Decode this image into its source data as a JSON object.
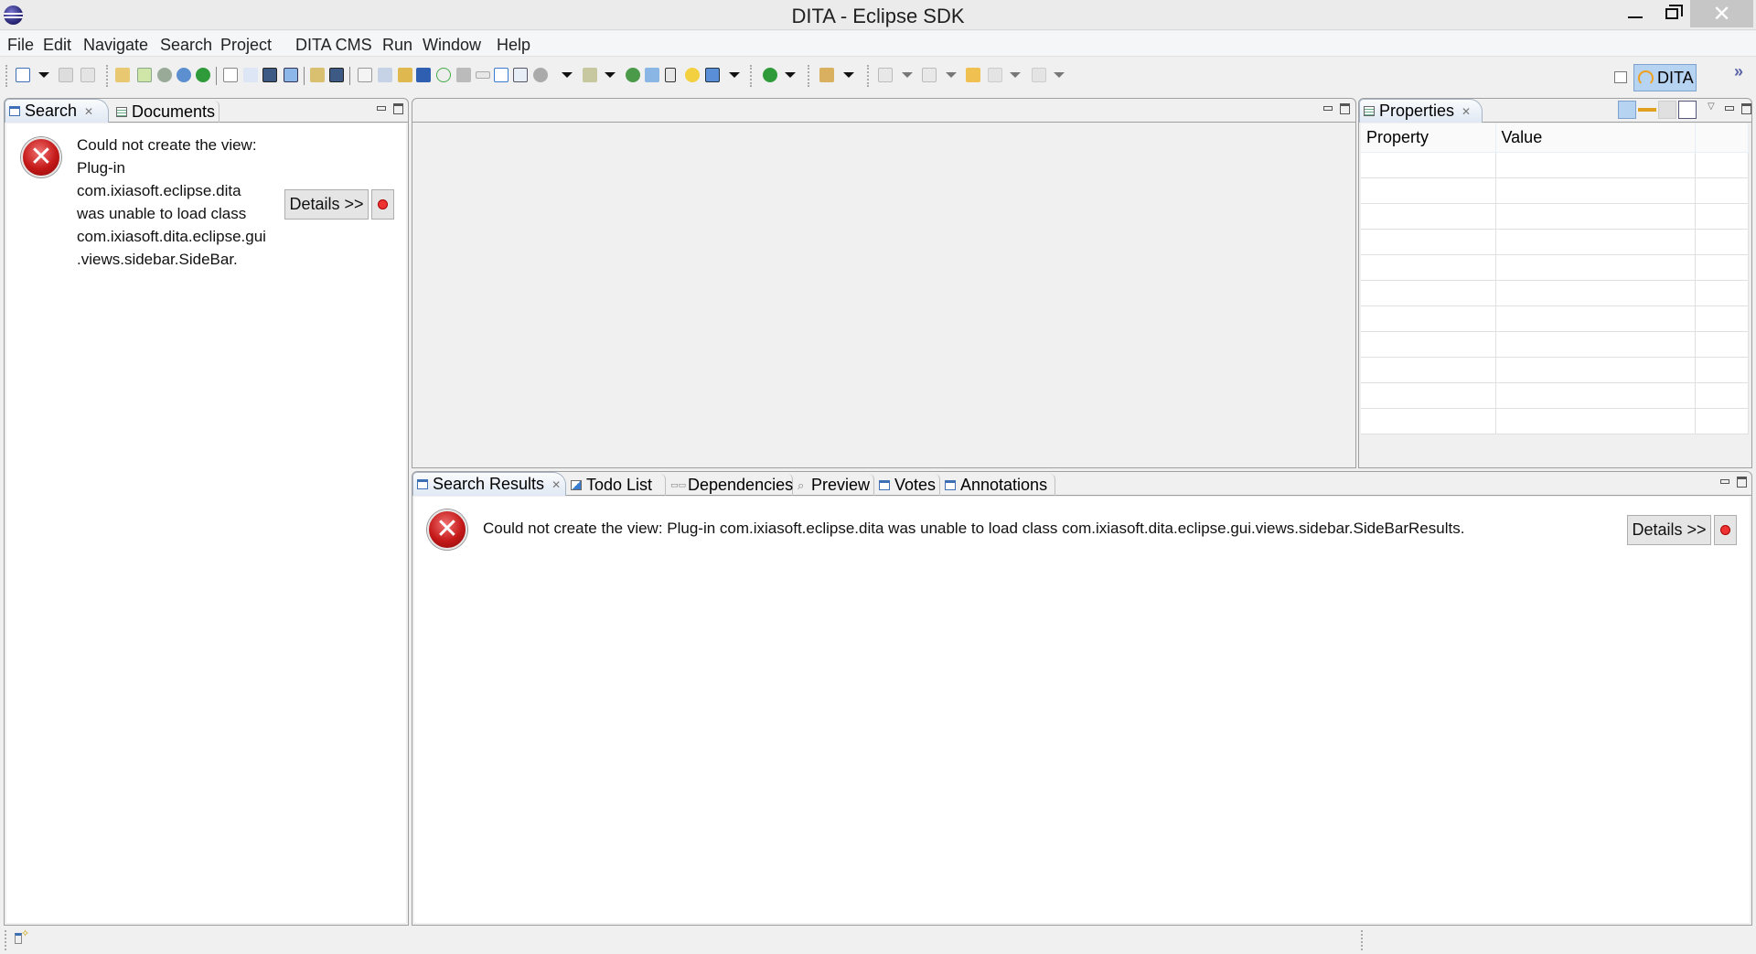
{
  "window": {
    "title": "DITA - Eclipse SDK",
    "controls": {
      "minimize": "minimize",
      "maximize": "restore",
      "close": "✕"
    }
  },
  "menu": [
    "File",
    "Edit",
    "Navigate",
    "Search",
    "Project",
    "DITA CMS",
    "Run",
    "Window",
    "Help"
  ],
  "toolbar": {
    "icons": [
      "new-wizard-icon",
      "save-icon",
      "print-icon",
      "spell-check-icon",
      "export-icon",
      "build-icon",
      "web-icon",
      "status-icon",
      "new-topic-icon",
      "new-map-icon",
      "image-icon",
      "new-folder-icon",
      "dictionary-icon",
      "image2-icon",
      "search-doc-icon",
      "tree-icon",
      "lock-icon",
      "workflow-icon",
      "at-icon",
      "document-icon",
      "dependencies-icon",
      "todo-icon",
      "table-icon",
      "link-icon",
      "filter-icon",
      "merge-icon",
      "eraser-icon",
      "hourglass-icon",
      "favorite-icon",
      "edit-icon",
      "run-icon",
      "annotate-icon",
      "next-annotation-icon",
      "prev-annotation-icon",
      "last-edit-icon",
      "back-icon",
      "forward-icon"
    ]
  },
  "perspective": {
    "label": "DITA",
    "open_perspective": "open-perspective-icon",
    "overflow": "»"
  },
  "left_pane": {
    "tabs": [
      {
        "label": "Search",
        "active": true,
        "closable": true
      },
      {
        "label": "Documents",
        "active": false
      }
    ],
    "error": {
      "lines": [
        "Could not create the view:",
        "Plug-in",
        "com.ixiasoft.eclipse.dita",
        "was unable to load class",
        "com.ixiasoft.dita.eclipse.gui",
        ".views.sidebar.SideBar."
      ],
      "details_label": "Details >>"
    }
  },
  "editor_pane": {
    "tabs": []
  },
  "properties_pane": {
    "tab": {
      "label": "Properties",
      "closable": true
    },
    "columns": [
      "Property",
      "Value",
      ""
    ],
    "rows": [
      [
        "",
        "",
        ""
      ],
      [
        "",
        "",
        ""
      ],
      [
        "",
        "",
        ""
      ],
      [
        "",
        "",
        ""
      ],
      [
        "",
        "",
        ""
      ],
      [
        "",
        "",
        ""
      ],
      [
        "",
        "",
        ""
      ],
      [
        "",
        "",
        ""
      ],
      [
        "",
        "",
        ""
      ],
      [
        "",
        "",
        ""
      ],
      [
        "",
        "",
        ""
      ]
    ],
    "toolbar": [
      "show-categories-icon",
      "show-advanced-icon",
      "restore-default-icon",
      "pin-icon",
      "view-menu-icon"
    ]
  },
  "bottom_pane": {
    "tabs": [
      {
        "label": "Search Results",
        "active": true,
        "closable": true,
        "icon": "view"
      },
      {
        "label": "Todo List",
        "icon": "todo"
      },
      {
        "label": "Dependencies",
        "icon": "dep"
      },
      {
        "label": "Preview",
        "icon": "prev"
      },
      {
        "label": "Votes",
        "icon": "view"
      },
      {
        "label": "Annotations",
        "icon": "view"
      }
    ],
    "error": {
      "message": "Could not create the view: Plug-in com.ixiasoft.eclipse.dita was unable to load class com.ixiasoft.dita.eclipse.gui.views.sidebar.SideBarResults.",
      "details_label": "Details >>"
    }
  },
  "colors": {
    "active_tab": "#dfe8f3",
    "perspective_highlight": "#b6d3f2",
    "error_red": "#c41818"
  }
}
